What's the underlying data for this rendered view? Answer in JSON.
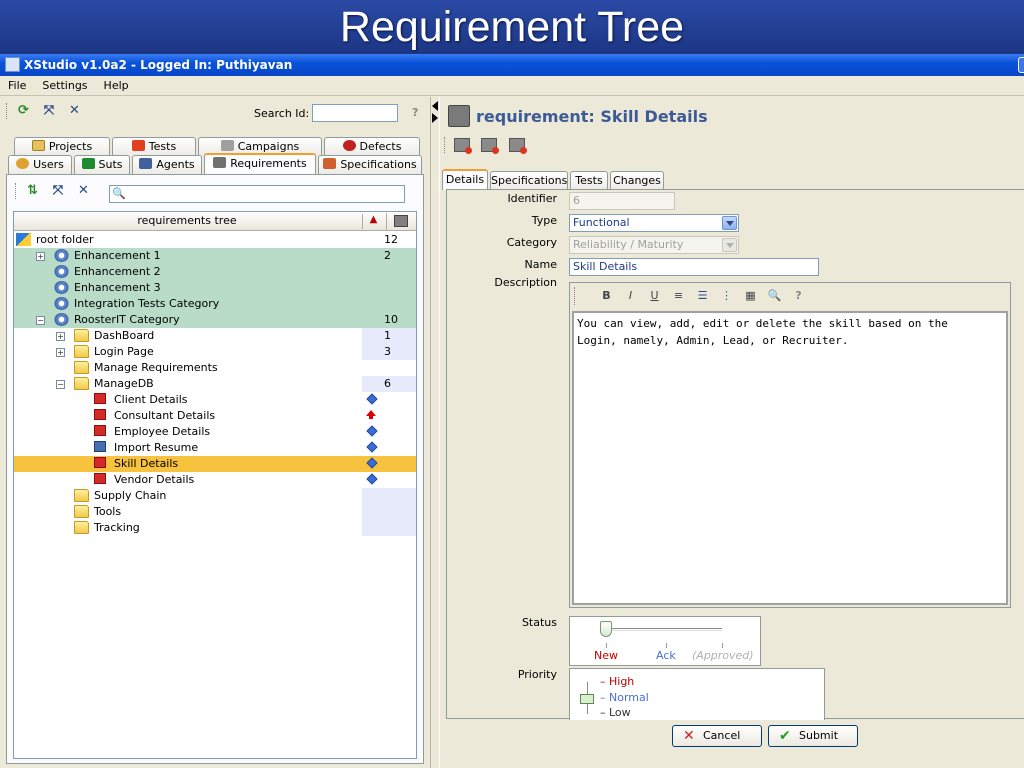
{
  "slide_title": "Requirement Tree",
  "window": {
    "title": "XStudio v1.0a2 - Logged In: Puthiyavan"
  },
  "menu": [
    "File",
    "Settings",
    "Help"
  ],
  "left": {
    "search_label": "Search Id:",
    "search_value": "",
    "help": "?",
    "tabs_row1": [
      "Projects",
      "Tests",
      "Campaigns",
      "Defects"
    ],
    "tabs_row2": [
      "Users",
      "Suts",
      "Agents",
      "Requirements",
      "Specifications"
    ],
    "active_tab": "Requirements",
    "tree_header": "requirements tree",
    "tree": [
      {
        "label": "root folder",
        "count": "12",
        "icon": "root",
        "level": 0,
        "bg": "white"
      },
      {
        "label": "Enhancement 1",
        "count": "2",
        "icon": "gear",
        "level": 1,
        "bg": "green",
        "expander": "+"
      },
      {
        "label": "Enhancement 2",
        "count": "",
        "icon": "gear",
        "level": 1,
        "bg": "green"
      },
      {
        "label": "Enhancement 3",
        "count": "",
        "icon": "gear",
        "level": 1,
        "bg": "green"
      },
      {
        "label": "Integration Tests Category",
        "count": "",
        "icon": "gear",
        "level": 1,
        "bg": "green"
      },
      {
        "label": "RoosterIT Category",
        "count": "10",
        "icon": "gear",
        "level": 1,
        "bg": "green",
        "expander": "−"
      },
      {
        "label": "DashBoard",
        "count": "1",
        "icon": "folder",
        "level": 2,
        "bg": "lavcol",
        "expander": "+"
      },
      {
        "label": "Login Page",
        "count": "3",
        "icon": "folder",
        "level": 2,
        "bg": "lavcol",
        "expander": "+"
      },
      {
        "label": "Manage Requirements",
        "count": "",
        "icon": "folder",
        "level": 2,
        "bg": "white"
      },
      {
        "label": "ManageDB",
        "count": "6",
        "icon": "folder",
        "level": 2,
        "bg": "lavcol",
        "expander": "−"
      },
      {
        "label": "Client Details",
        "count": "",
        "icon": "req",
        "level": 3,
        "bg": "white",
        "mark": "diamond"
      },
      {
        "label": "Consultant Details",
        "count": "",
        "icon": "req",
        "level": 3,
        "bg": "white",
        "mark": "up"
      },
      {
        "label": "Employee Details",
        "count": "",
        "icon": "req",
        "level": 3,
        "bg": "white",
        "mark": "diamond"
      },
      {
        "label": "Import Resume",
        "count": "",
        "icon": "reqblue",
        "level": 3,
        "bg": "white",
        "mark": "diamond"
      },
      {
        "label": "Skill Details",
        "count": "",
        "icon": "req",
        "level": 3,
        "bg": "selected",
        "mark": "diamond"
      },
      {
        "label": "Vendor Details",
        "count": "",
        "icon": "req",
        "level": 3,
        "bg": "white",
        "mark": "diamond"
      },
      {
        "label": "Supply Chain",
        "count": "",
        "icon": "folder",
        "level": 2,
        "bg": "lavcol"
      },
      {
        "label": "Tools",
        "count": "",
        "icon": "folder",
        "level": 2,
        "bg": "lavcol"
      },
      {
        "label": "Tracking",
        "count": "",
        "icon": "folder",
        "level": 2,
        "bg": "lavcol"
      }
    ]
  },
  "right": {
    "heading": "requirement: Skill Details",
    "tabs": [
      "Details",
      "Specifications",
      "Tests",
      "Changes"
    ],
    "active_tab": "Details",
    "fields": {
      "identifier_label": "Identifier",
      "identifier": "6",
      "type_label": "Type",
      "type": "Functional",
      "category_label": "Category",
      "category": "Reliability / Maturity",
      "name_label": "Name",
      "name": "Skill Details",
      "description_label": "Description",
      "description": "You can view, add, edit or delete the skill based on the\nLogin, namely, Admin, Lead, or Recruiter."
    },
    "editor_tools": [
      "B",
      "I",
      "U",
      "≡",
      "☰",
      "⋮",
      "▦",
      "🔍",
      "?"
    ],
    "status_label": "Status",
    "status_steps": [
      "New",
      "Ack",
      "(Approved)"
    ],
    "status_value": "New",
    "priority_label": "Priority",
    "priority_options": [
      "High",
      "Normal",
      "Low"
    ],
    "priority_value": "Normal",
    "cancel": "Cancel",
    "submit": "Submit"
  },
  "colors": {
    "accent": "#3d5a96",
    "green_row": "#b9dcc8",
    "selected_row": "#f7c23e",
    "lavender_col": "#e6eafb",
    "high": "#c00000",
    "normal": "#4a6fd0"
  }
}
